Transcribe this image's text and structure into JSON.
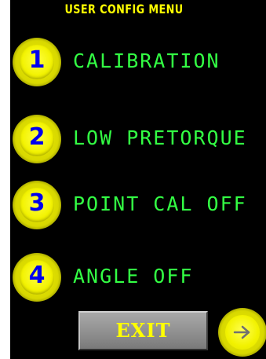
{
  "header": {
    "title": "USER CONFIG MENU"
  },
  "menu": {
    "items": [
      {
        "number": "1",
        "label": "CALIBRATION"
      },
      {
        "number": "2",
        "label": "LOW PRETORQUE"
      },
      {
        "number": "3",
        "label": "POINT CAL OFF"
      },
      {
        "number": "4",
        "label": "ANGLE OFF"
      }
    ]
  },
  "footer": {
    "exit_label": "EXIT",
    "next_icon": "arrow-right-icon"
  },
  "colors": {
    "background": "#000000",
    "title": "#ffff00",
    "label": "#33ff44",
    "number": "#0000ee",
    "button_yellow": "#f2f200",
    "exit_gray": "#8f8f8f"
  }
}
